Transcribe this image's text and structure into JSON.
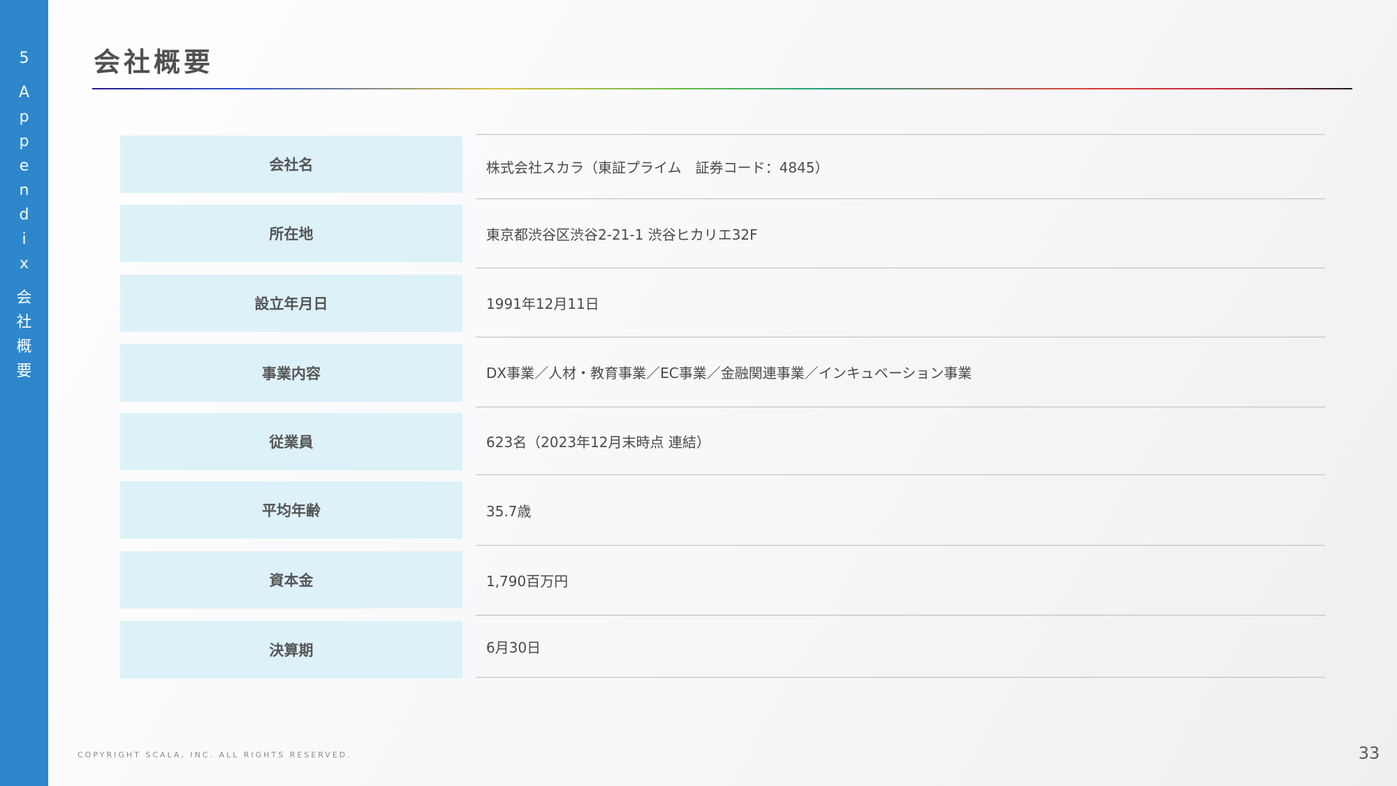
{
  "sidebar": {
    "section_number": "5",
    "section_name_chars": [
      "A",
      "p",
      "p",
      "e",
      "n",
      "d",
      "i",
      "x"
    ],
    "section_title_chars": [
      "会",
      "社",
      "概",
      "要"
    ]
  },
  "header": {
    "title": "会社概要"
  },
  "rows": [
    {
      "label": "会社名",
      "value": "株式会社スカラ（東証プライム　証券コード：4845）"
    },
    {
      "label": "所在地",
      "value": "東京都渋谷区渋谷2-21-1 渋谷ヒカリエ32F"
    },
    {
      "label": "設立年月日",
      "value": "1991年12月11日"
    },
    {
      "label": "事業内容",
      "value": "DX事業／人材・教育事業／EC事業／金融関連事業／インキュベーション事業"
    },
    {
      "label": "従業員",
      "value": "623名（2023年12月末時点 連結）"
    },
    {
      "label": "平均年齢",
      "value": "35.7歳"
    },
    {
      "label": "資本金",
      "value": "1,790百万円"
    },
    {
      "label": "決算期",
      "value": "6月30日"
    }
  ],
  "footer": {
    "copyright": "COPYRIGHT SCALA, INC. ALL RIGHTS RESERVED.",
    "page_number": "33"
  },
  "colors": {
    "sidebar": "#2e87cb",
    "label_background": "#ddf1f9"
  }
}
